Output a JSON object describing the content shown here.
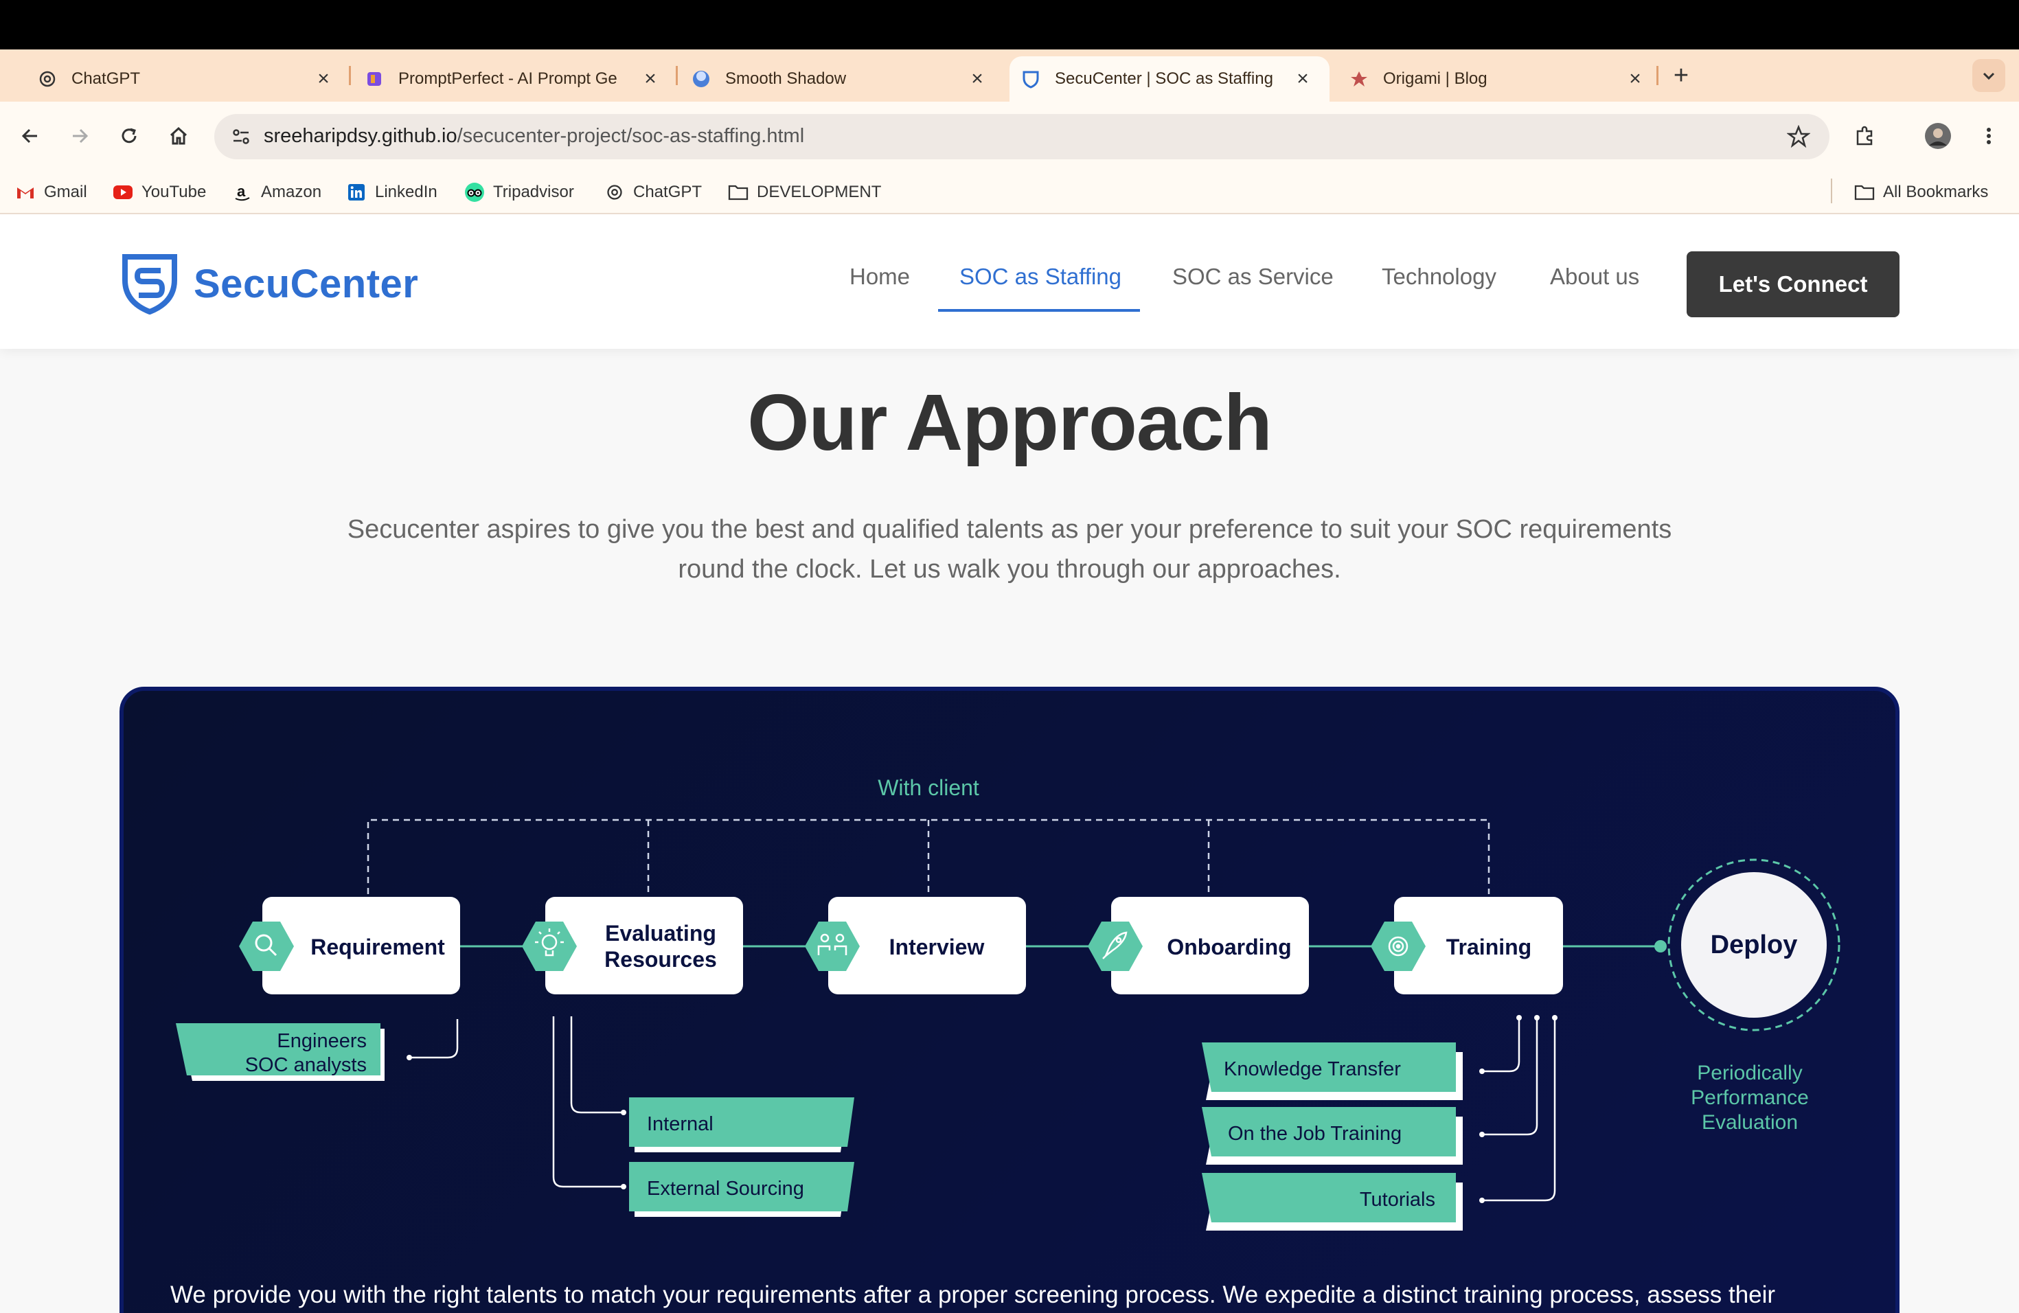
{
  "browser": {
    "tabs": [
      {
        "title": "ChatGPT",
        "icon": "openai-icon",
        "active": false
      },
      {
        "title": "PromptPerfect - AI Prompt Ge",
        "icon": "promptperfect-icon",
        "active": false
      },
      {
        "title": "Smooth Shadow",
        "icon": "smooth-shadow-icon",
        "active": false
      },
      {
        "title": "SecuCenter | SOC as Staffing",
        "icon": "secucenter-shield-icon",
        "active": true
      },
      {
        "title": "Origami | Blog",
        "icon": "origami-icon",
        "active": false
      }
    ],
    "url_host": "sreeharipdsy.github.io",
    "url_path": "/secucenter-project/soc-as-staffing.html",
    "bookmarks": [
      "Gmail",
      "YouTube",
      "Amazon",
      "LinkedIn",
      "Tripadvisor",
      "ChatGPT",
      "DEVELOPMENT"
    ],
    "all_bookmarks": "All Bookmarks"
  },
  "site": {
    "brand": "SecuCenter",
    "nav": [
      "Home",
      "SOC as Staffing",
      "SOC as Service",
      "Technology",
      "About us"
    ],
    "active_nav": "SOC as Staffing",
    "cta": "Let's Connect",
    "brand_color": "#2f6fd1"
  },
  "approach": {
    "title": "Our Approach",
    "description_line1": "Secucenter aspires to give you the best and qualified talents as per your preference to suit your SOC requirements",
    "description_line2": "round the clock. Let us walk you through our approaches.",
    "diagram": {
      "client_label": "With client",
      "steps": [
        {
          "label_line1": "Requirement",
          "label_line2": "",
          "icon": "search-icon"
        },
        {
          "label_line1": "Evaluating",
          "label_line2": "Resources",
          "icon": "lightbulb-icon"
        },
        {
          "label_line1": "Interview",
          "label_line2": "",
          "icon": "people-icon"
        },
        {
          "label_line1": "Onboarding",
          "label_line2": "",
          "icon": "rocket-icon"
        },
        {
          "label_line1": "Training",
          "label_line2": "",
          "icon": "target-icon"
        }
      ],
      "final_step": "Deploy",
      "final_note_line1": "Periodically",
      "final_note_line2": "Performance",
      "final_note_line3": "Evaluation",
      "requirement_tags_line1": "Engineers",
      "requirement_tags_line2": "SOC analysts",
      "evaluating_tags": [
        "Internal",
        "External Sourcing"
      ],
      "training_tags": [
        "Knowledge Transfer",
        "On the Job Training",
        "Tutorials"
      ],
      "accent_color": "#5cc7a8"
    },
    "footer_text": "We provide you with the right talents to match your requirements after a proper screening process. We expedite a distinct training process, assess their"
  }
}
